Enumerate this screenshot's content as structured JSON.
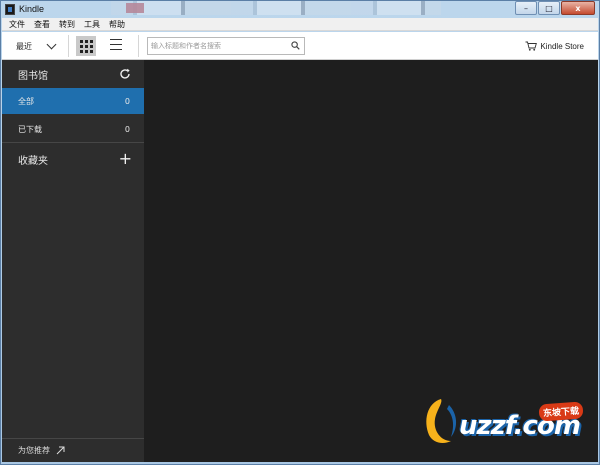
{
  "window": {
    "title": "Kindle",
    "minimize_glyph": "–",
    "maximize_glyph": "□",
    "close_glyph": "x"
  },
  "menu": {
    "items": [
      "文件",
      "查看",
      "转到",
      "工具",
      "帮助"
    ]
  },
  "toolbar": {
    "sort_label": "最近",
    "search_placeholder": "输入标题和作者名搜索",
    "store_label": "Kindle Store",
    "grid_view_icon": "grid-icon",
    "list_view_icon": "list-icon"
  },
  "sidebar": {
    "library_title": "图书馆",
    "items": [
      {
        "label": "全部",
        "count": "0",
        "selected": true
      },
      {
        "label": "已下载",
        "count": "0",
        "selected": false
      }
    ],
    "collections_title": "收藏夹",
    "recommend_label": "为您推荐"
  },
  "watermark": {
    "text": "uzzf.com",
    "badge": "东坡下载"
  },
  "colors": {
    "selected": "#1f6fae",
    "sidebar_bg": "#2d2d2d",
    "content_bg": "#1e1e1e"
  }
}
